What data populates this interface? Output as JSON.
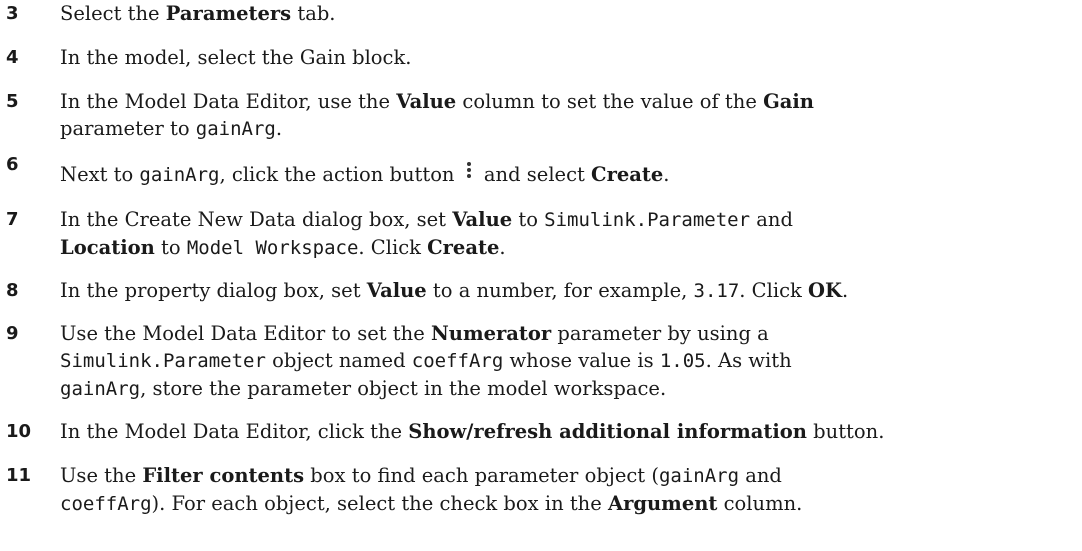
{
  "steps": [
    {
      "num": "3",
      "t1": "Select the ",
      "b1": "Parameters",
      "t2": " tab."
    },
    {
      "num": "4",
      "t1": "In the model, select the Gain block."
    },
    {
      "num": "5",
      "t1": "In the Model Data Editor, use the ",
      "b1": "Value",
      "t2": " column to set the value of the ",
      "b2": "Gain",
      "t3": "parameter to ",
      "c1": "gainArg",
      "t4": "."
    },
    {
      "num": "6",
      "t1": "Next to ",
      "c1": "gainArg",
      "t2": ", click the action button ",
      "t3": " and select ",
      "b1": "Create",
      "t4": ".",
      "icon": "vertical-ellipsis-icon"
    },
    {
      "num": "7",
      "t1": "In the Create New Data dialog box, set ",
      "b1": "Value",
      "t2": " to ",
      "c1": "Simulink.Parameter",
      "t3": " and",
      "b2": "Location",
      "t4": " to ",
      "c2": "Model Workspace",
      "t5": ". Click ",
      "b3": "Create",
      "t6": "."
    },
    {
      "num": "8",
      "t1": "In the property dialog box, set ",
      "b1": "Value",
      "t2": " to a number, for example, ",
      "c1": "3.17",
      "t3": ". Click ",
      "b2": "OK",
      "t4": "."
    },
    {
      "num": "9",
      "t1": "Use the Model Data Editor to set the ",
      "b1": "Numerator",
      "t2": " parameter by using a",
      "c1": "Simulink.Parameter",
      "t3": " object named ",
      "c2": "coeffArg",
      "t4": " whose value is ",
      "c3": "1.05",
      "t5": ". As with",
      "c4": "gainArg",
      "t6": ", store the parameter object in the model workspace."
    },
    {
      "num": "10",
      "t1": "In the Model Data Editor, click the ",
      "b1": "Show/refresh additional information",
      "t2": " button."
    },
    {
      "num": "11",
      "t1": "Use the ",
      "b1": "Filter contents",
      "t2": " box to find each parameter object (",
      "c1": "gainArg",
      "t3": " and",
      "c2": "coeffArg",
      "t4": "). For each object, select the check box in the ",
      "b2": "Argument",
      "t5": " column."
    }
  ]
}
